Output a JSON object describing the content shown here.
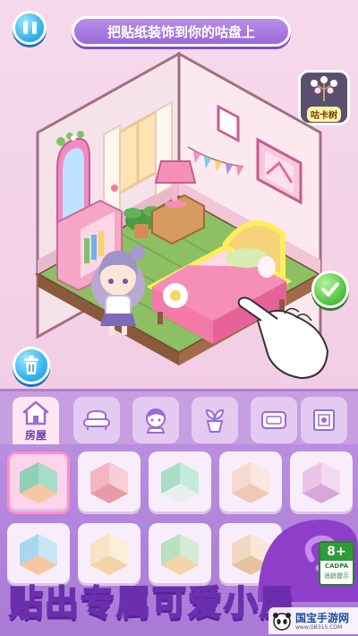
{
  "top": {
    "banner_text": "把贴纸装饰到你的咕盘上",
    "tree_label": "咕卡树"
  },
  "tabs": [
    {
      "label": "房屋",
      "icon": "house-icon",
      "active": true
    },
    {
      "label": "",
      "icon": "sofa-icon"
    },
    {
      "label": "",
      "icon": "character-icon"
    },
    {
      "label": "",
      "icon": "plant-icon"
    },
    {
      "label": "",
      "icon": "rug-icon"
    },
    {
      "label": "",
      "icon": "frame-icon"
    }
  ],
  "grid_items": [
    {
      "name": "room-style-1",
      "selected": true
    },
    {
      "name": "room-style-2"
    },
    {
      "name": "room-style-3"
    },
    {
      "name": "room-style-4"
    },
    {
      "name": "room-style-5"
    },
    {
      "name": "room-style-6"
    },
    {
      "name": "room-style-7"
    },
    {
      "name": "room-style-8"
    },
    {
      "name": "room-style-9"
    }
  ],
  "slogan": "贴出专属可爱小屋",
  "age_rating": {
    "value": "8+",
    "org": "CADPA",
    "note": "适龄提示"
  },
  "watermark": {
    "text": "国宝手游网",
    "url": "www.GB315.COM"
  },
  "colors": {
    "accent_purple": "#9a6ad8",
    "accent_pink": "#ff8fc6",
    "wall": "#f4dde7",
    "floor": "#8dbf63"
  }
}
